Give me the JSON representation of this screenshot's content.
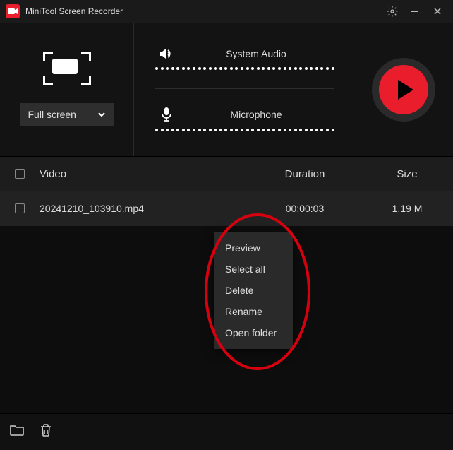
{
  "titlebar": {
    "title": "MiniTool Screen Recorder"
  },
  "capture": {
    "mode_label": "Full screen"
  },
  "audio": {
    "system_label": "System Audio",
    "mic_label": "Microphone"
  },
  "list": {
    "headers": {
      "video": "Video",
      "duration": "Duration",
      "size": "Size"
    },
    "rows": [
      {
        "name": "20241210_103910.mp4",
        "duration": "00:00:03",
        "size": "1.19 M"
      }
    ]
  },
  "context_menu": {
    "items": [
      "Preview",
      "Select all",
      "Delete",
      "Rename",
      "Open folder"
    ]
  }
}
